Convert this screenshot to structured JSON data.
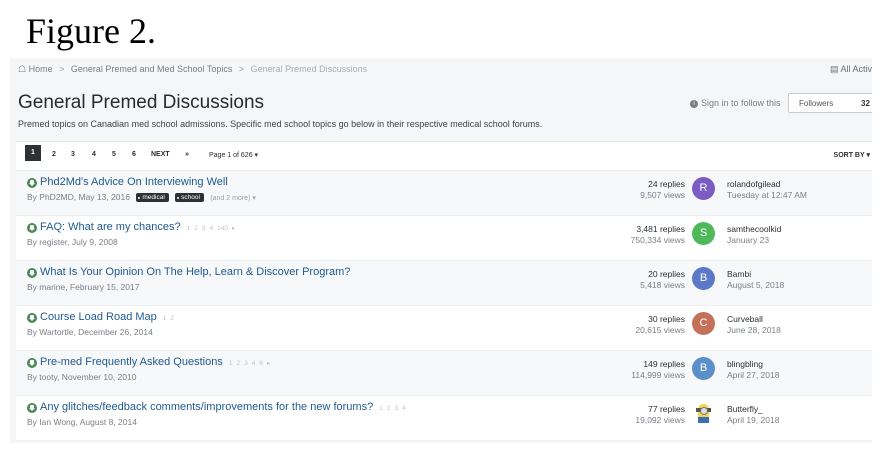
{
  "figure_caption": "Figure 2.",
  "breadcrumb": {
    "home": "Home",
    "sep": ">",
    "level1": "General Premed and Med School Topics",
    "current": "General Premed Discussions"
  },
  "all_activity": "All Activ",
  "page_title": "General Premed Discussions",
  "page_description": "Premed topics on Canadian med school admissions. Specific med school topics go below in their respective medical school forums.",
  "follow": {
    "sign_in": "Sign in to follow this",
    "followers_label": "Followers",
    "followers_count": "32"
  },
  "pagination": {
    "pages": [
      "1",
      "2",
      "3",
      "4",
      "5",
      "6"
    ],
    "active": "1",
    "next": "NEXT",
    "last": "»",
    "page_of": "Page 1 of 626",
    "sort_by": "SORT BY"
  },
  "topics": [
    {
      "title": "Phd2Md's Advice On Interviewing Well",
      "byline": "By PhD2MD, May 13, 2016",
      "tags": [
        "medical",
        "school"
      ],
      "more_tags": "(and 2 more)",
      "mini_pages": [],
      "replies": "24 replies",
      "views": "9,507 views",
      "avatar_letter": "R",
      "avatar_color": "#7a5cc4",
      "last_user": "rolandofgilead",
      "last_date": "Tuesday at 12:47 AM"
    },
    {
      "title": "FAQ: What are my chances?",
      "byline": "By register, July 9, 2008",
      "tags": [],
      "more_tags": "",
      "mini_pages": [
        "1",
        "2",
        "3",
        "4",
        "140"
      ],
      "replies": "3,481 replies",
      "views": "750,334 views",
      "avatar_letter": "S",
      "avatar_color": "#4fb85a",
      "last_user": "samthecoolkid",
      "last_date": "January 23"
    },
    {
      "title": "What Is Your Opinion On The Help, Learn & Discover Program?",
      "byline": "By marine, February 15, 2017",
      "tags": [],
      "more_tags": "",
      "mini_pages": [],
      "replies": "20 replies",
      "views": "5,418 views",
      "avatar_letter": "B",
      "avatar_color": "#5b78c9",
      "last_user": "Bambi",
      "last_date": "August 5, 2018"
    },
    {
      "title": "Course Load Road Map",
      "byline": "By Wartortle, December 26, 2014",
      "tags": [],
      "more_tags": "",
      "mini_pages": [
        "1",
        "2"
      ],
      "replies": "30 replies",
      "views": "20,615 views",
      "avatar_letter": "C",
      "avatar_color": "#c4705a",
      "last_user": "Curveball",
      "last_date": "June 28, 2018"
    },
    {
      "title": "Pre-med Frequently Asked Questions",
      "byline": "By tooty, November 10, 2010",
      "tags": [],
      "more_tags": "",
      "mini_pages": [
        "1",
        "2",
        "3",
        "4",
        "6"
      ],
      "replies": "149 replies",
      "views": "114,999 views",
      "avatar_letter": "B",
      "avatar_color": "#5a8fc9",
      "last_user": "blingbling",
      "last_date": "April 27, 2018"
    },
    {
      "title": "Any glitches/feedback comments/improvements for the new forums?",
      "byline": "By Ian Wong, August 8, 2014",
      "tags": [],
      "more_tags": "",
      "mini_pages": [
        "1",
        "2",
        "3",
        "4"
      ],
      "replies": "77 replies",
      "views": "19,092 views",
      "avatar_letter": "",
      "avatar_color": "#ffffff",
      "last_user": "Butterfly_",
      "last_date": "April 19, 2018"
    }
  ],
  "colors": {
    "pin": "#4a8a57",
    "link": "#1f5a8f"
  }
}
